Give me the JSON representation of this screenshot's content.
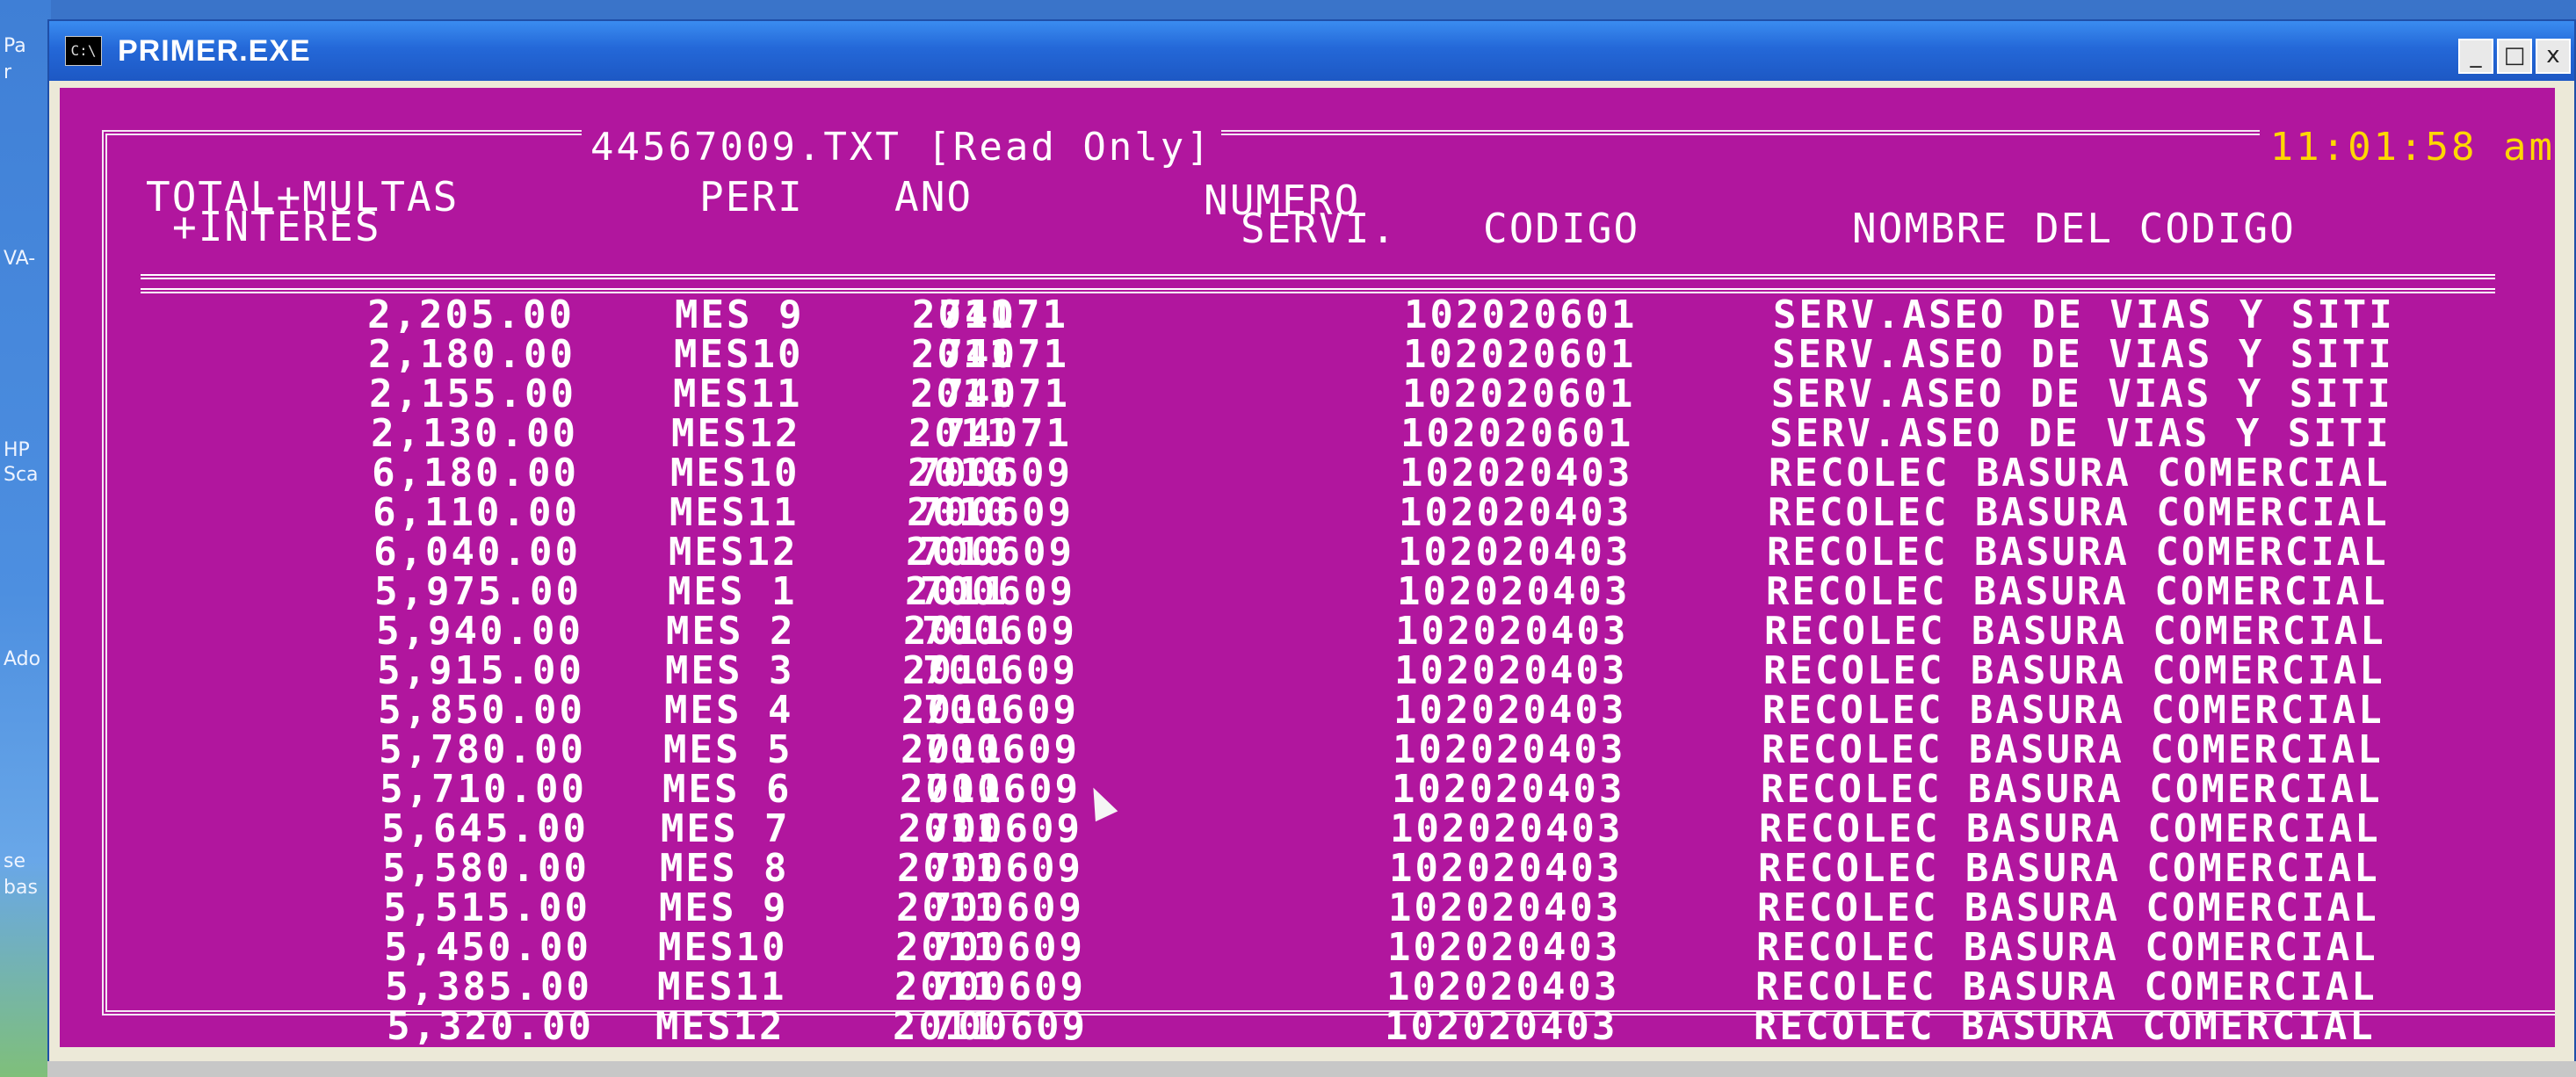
{
  "desktop": {
    "labels": [
      "Pa",
      "r",
      "VA-",
      "HP",
      "Sca",
      "Ado",
      "se",
      "bas"
    ]
  },
  "window": {
    "title": "PRIMER.EXE",
    "icon_text": "C:\\",
    "buttons": {
      "minimize": "_",
      "maximize": "□",
      "close": "x"
    }
  },
  "console": {
    "file_title": "44567009.TXT [Read Only]",
    "clock": "11:01:58 am",
    "headers": {
      "total_line1": "TOTAL+MULTAS",
      "total_line2": "+INTERES",
      "peri": "PERI",
      "ano": "ANO",
      "numero_line1": "NUMERO",
      "numero_line2": "SERVI.",
      "codigo": "CODIGO",
      "nombre": "NOMBRE DEL CODIGO"
    },
    "rows": [
      {
        "total": "2,205.00",
        "peri": "MES 9",
        "ano": "2011",
        "numero": "74071",
        "codigo": "102020601",
        "nombre": "SERV.ASEO DE VIAS Y SITI"
      },
      {
        "total": "2,180.00",
        "peri": "MES10",
        "ano": "2011",
        "numero": "74071",
        "codigo": "102020601",
        "nombre": "SERV.ASEO DE VIAS Y SITI"
      },
      {
        "total": "2,155.00",
        "peri": "MES11",
        "ano": "2011",
        "numero": "74071",
        "codigo": "102020601",
        "nombre": "SERV.ASEO DE VIAS Y SITI"
      },
      {
        "total": "2,130.00",
        "peri": "MES12",
        "ano": "2011",
        "numero": "74071",
        "codigo": "102020601",
        "nombre": "SERV.ASEO DE VIAS Y SITI"
      },
      {
        "total": "6,180.00",
        "peri": "MES10",
        "ano": "2010",
        "numero": "700609",
        "codigo": "102020403",
        "nombre": "RECOLEC BASURA COMERCIAL"
      },
      {
        "total": "6,110.00",
        "peri": "MES11",
        "ano": "2010",
        "numero": "700609",
        "codigo": "102020403",
        "nombre": "RECOLEC BASURA COMERCIAL"
      },
      {
        "total": "6,040.00",
        "peri": "MES12",
        "ano": "2010",
        "numero": "700609",
        "codigo": "102020403",
        "nombre": "RECOLEC BASURA COMERCIAL"
      },
      {
        "total": "5,975.00",
        "peri": "MES 1",
        "ano": "2011",
        "numero": "700609",
        "codigo": "102020403",
        "nombre": "RECOLEC BASURA COMERCIAL"
      },
      {
        "total": "5,940.00",
        "peri": "MES 2",
        "ano": "2011",
        "numero": "700609",
        "codigo": "102020403",
        "nombre": "RECOLEC BASURA COMERCIAL"
      },
      {
        "total": "5,915.00",
        "peri": "MES 3",
        "ano": "2011",
        "numero": "700609",
        "codigo": "102020403",
        "nombre": "RECOLEC BASURA COMERCIAL"
      },
      {
        "total": "5,850.00",
        "peri": "MES 4",
        "ano": "2011",
        "numero": "700609",
        "codigo": "102020403",
        "nombre": "RECOLEC BASURA COMERCIAL"
      },
      {
        "total": "5,780.00",
        "peri": "MES 5",
        "ano": "2011",
        "numero": "700609",
        "codigo": "102020403",
        "nombre": "RECOLEC BASURA COMERCIAL"
      },
      {
        "total": "5,710.00",
        "peri": "MES 6",
        "ano": "2011",
        "numero": "700609",
        "codigo": "102020403",
        "nombre": "RECOLEC BASURA COMERCIAL"
      },
      {
        "total": "5,645.00",
        "peri": "MES 7",
        "ano": "2011",
        "numero": "700609",
        "codigo": "102020403",
        "nombre": "RECOLEC BASURA COMERCIAL"
      },
      {
        "total": "5,580.00",
        "peri": "MES 8",
        "ano": "2011",
        "numero": "700609",
        "codigo": "102020403",
        "nombre": "RECOLEC BASURA COMERCIAL"
      },
      {
        "total": "5,515.00",
        "peri": "MES 9",
        "ano": "2011",
        "numero": "700609",
        "codigo": "102020403",
        "nombre": "RECOLEC BASURA COMERCIAL"
      },
      {
        "total": "5,450.00",
        "peri": "MES10",
        "ano": "2011",
        "numero": "700609",
        "codigo": "102020403",
        "nombre": "RECOLEC BASURA COMERCIAL"
      },
      {
        "total": "5,385.00",
        "peri": "MES11",
        "ano": "2011",
        "numero": "700609",
        "codigo": "102020403",
        "nombre": "RECOLEC BASURA COMERCIAL"
      },
      {
        "total": "5,320.00",
        "peri": "MES12",
        "ano": "2011",
        "numero": "700609",
        "codigo": "102020403",
        "nombre": "RECOLEC BASURA COMERCIAL"
      }
    ]
  },
  "colors": {
    "console_bg": "#b1169e",
    "text": "#ffffff",
    "clock": "#ffd700",
    "titlebar": "#2468d8"
  }
}
